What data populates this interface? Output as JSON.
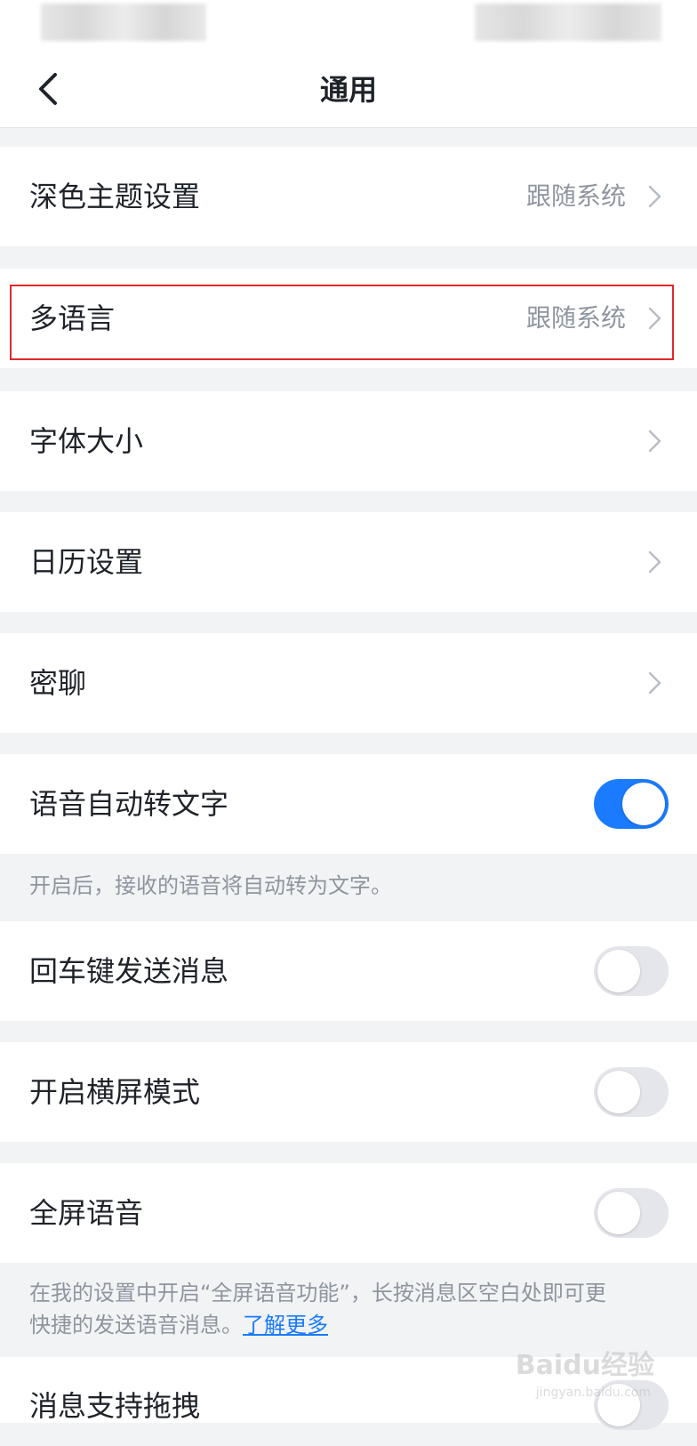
{
  "nav": {
    "title": "通用",
    "back_icon": "chevron-left-icon"
  },
  "settings": {
    "dark_theme": {
      "label": "深色主题设置",
      "value": "跟随系统"
    },
    "language": {
      "label": "多语言",
      "value": "跟随系统"
    },
    "font_size": {
      "label": "字体大小"
    },
    "calendar": {
      "label": "日历设置"
    },
    "secret_chat": {
      "label": "密聊"
    },
    "voice_to_text": {
      "label": "语音自动转文字",
      "enabled": true,
      "caption": "开启后，接收的语音将自动转为文字。"
    },
    "enter_send": {
      "label": "回车键发送消息",
      "enabled": false
    },
    "landscape": {
      "label": "开启横屏模式",
      "enabled": false
    },
    "fullscreen_voice": {
      "label": "全屏语音",
      "enabled": false,
      "caption_line1": "在我的设置中开启“全屏语音功能”，长按消息区空白处即可更",
      "caption_line2": "快捷的发送语音消息。",
      "caption_link": "了解更多"
    },
    "drag_message": {
      "label": "消息支持拖拽"
    }
  },
  "watermark": {
    "brand": "Baidu经验",
    "url": "jingyan.baidu.com"
  },
  "colors": {
    "accent": "#1a7bff",
    "highlight_border": "#e0292b",
    "page_background": "#f2f3f5",
    "toggle_off": "#e5e6eb"
  }
}
